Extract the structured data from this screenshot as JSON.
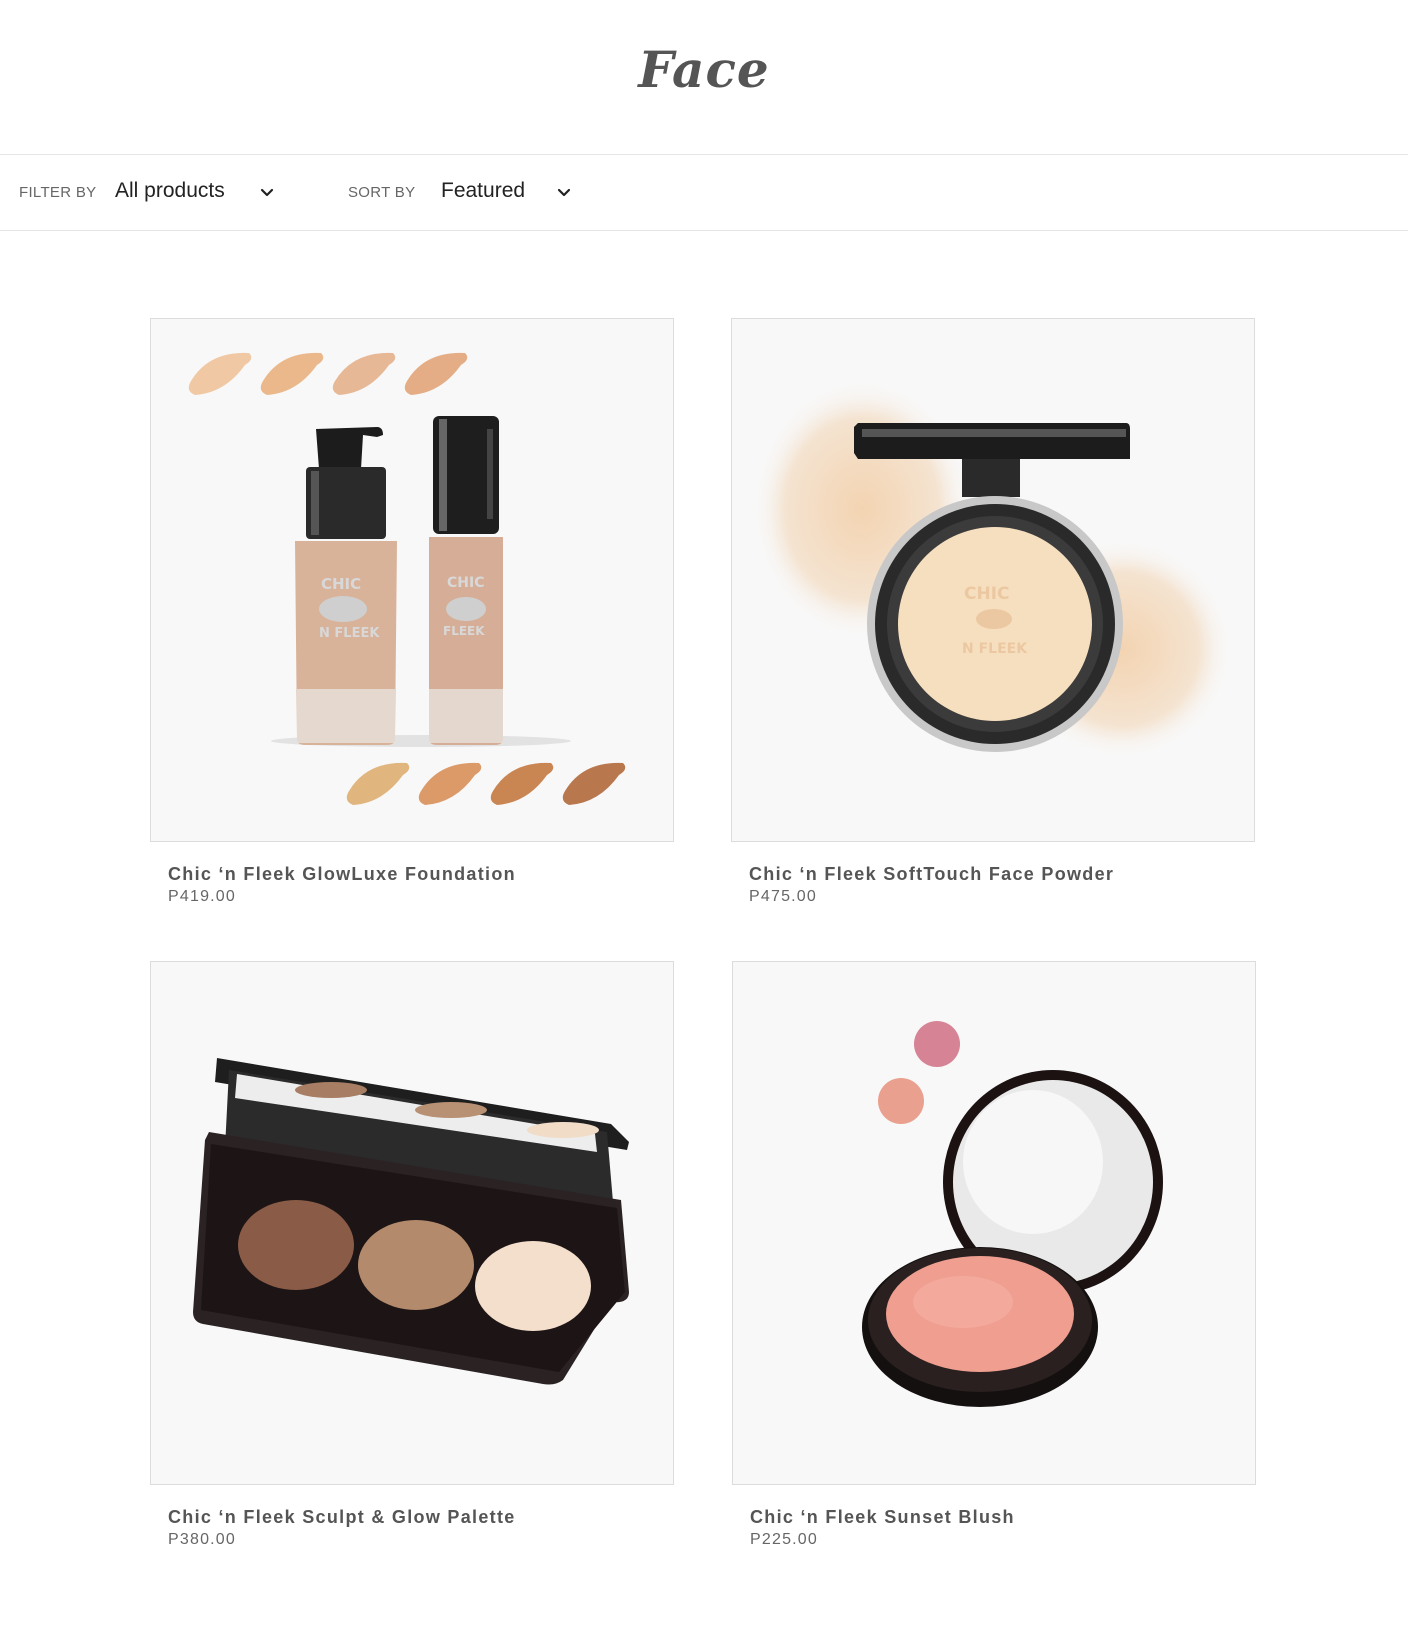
{
  "page": {
    "title": "Face"
  },
  "toolbar": {
    "filter_label": "FILTER BY",
    "filter_value": "All products",
    "sort_label": "SORT BY",
    "sort_value": "Featured"
  },
  "products": [
    {
      "name": "Chic ‘n Fleek GlowLuxe Foundation",
      "price": "P419.00"
    },
    {
      "name": "Chic ‘n Fleek SoftTouch Face Powder",
      "price": "P475.00"
    },
    {
      "name": "Chic ‘n Fleek Sculpt & Glow Palette",
      "price": "P380.00"
    },
    {
      "name": "Chic ‘n Fleek Sunset Blush",
      "price": "P225.00"
    }
  ],
  "product_images": [
    {
      "icon": "foundation-bottles-image",
      "brand_text": "CHIC 'N FLEEK"
    },
    {
      "icon": "face-powder-compact-image",
      "brand_text": "CHIC 'N FLEEK"
    },
    {
      "icon": "contour-palette-image"
    },
    {
      "icon": "blush-compact-image"
    }
  ]
}
